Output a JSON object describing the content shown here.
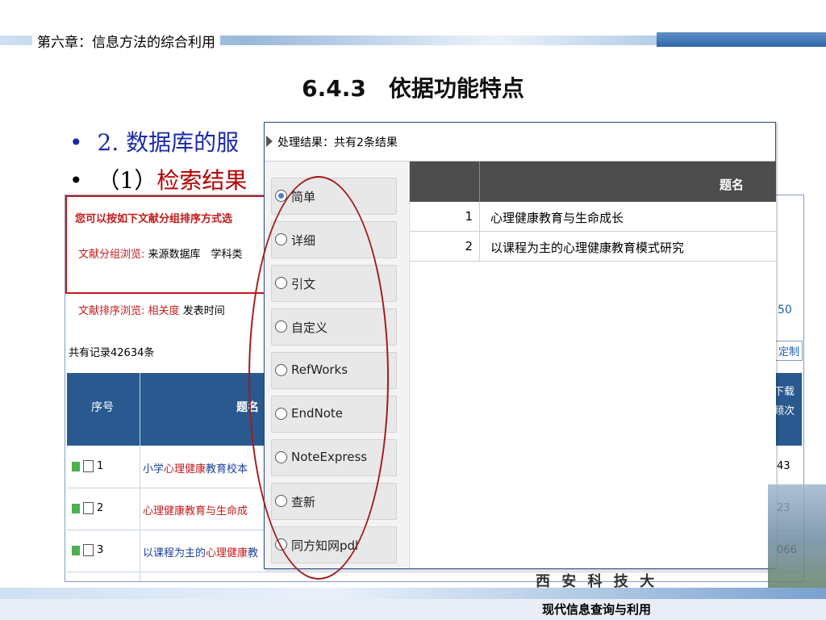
{
  "slide": {
    "chapter": "第六章：信息方法的综合利用",
    "heading": "6.4.3　依据功能特点",
    "bullet1": "2. 数据库的服",
    "bullet2_prefix": "（1）",
    "bullet2_red": "检索结果",
    "footer": "现代信息查询与利用",
    "logo_text": "西 安 科 技 大 学"
  },
  "background": {
    "group_hint": "您可以按如下文献分组排序方式选",
    "group_label": "文献分组浏览:",
    "group_items": "来源数据库　学科类",
    "sort_label": "文献排序浏览:",
    "sort_active": "相关度",
    "sort_item": "发表时间",
    "count": "共有记录42634条",
    "per_page": "50",
    "custom": "定制",
    "header": {
      "no": "序号",
      "title": "题名",
      "downloads": "下载频次"
    },
    "rows": [
      {
        "no": "1",
        "pre": "小学",
        "hl": "心理健康",
        "post": "教育校本",
        "dl": "43"
      },
      {
        "no": "2",
        "pre": "",
        "hl": "心理健康",
        "post": "教育与生命成",
        "dl": "23"
      },
      {
        "no": "3",
        "pre": "以课程为主的",
        "hl": "心理健康",
        "post": "教",
        "dl": "066"
      }
    ]
  },
  "popup": {
    "title": "处理结果：共有2条结果",
    "options": [
      "简单",
      "详细",
      "引文",
      "自定义",
      "RefWorks",
      "EndNote",
      "NoteExpress",
      "查新",
      "同方知网pdl"
    ],
    "selected": 0,
    "column_title": "题名",
    "results": [
      {
        "no": "1",
        "title": "心理健康教育与生命成长"
      },
      {
        "no": "2",
        "title": "以课程为主的心理健康教育模式研究"
      }
    ]
  },
  "colors": {
    "accent_red": "#c51a1a",
    "header_blue": "#29598f",
    "popup_header": "#4d4d4d",
    "bullet_blue": "#1a2aa8"
  }
}
